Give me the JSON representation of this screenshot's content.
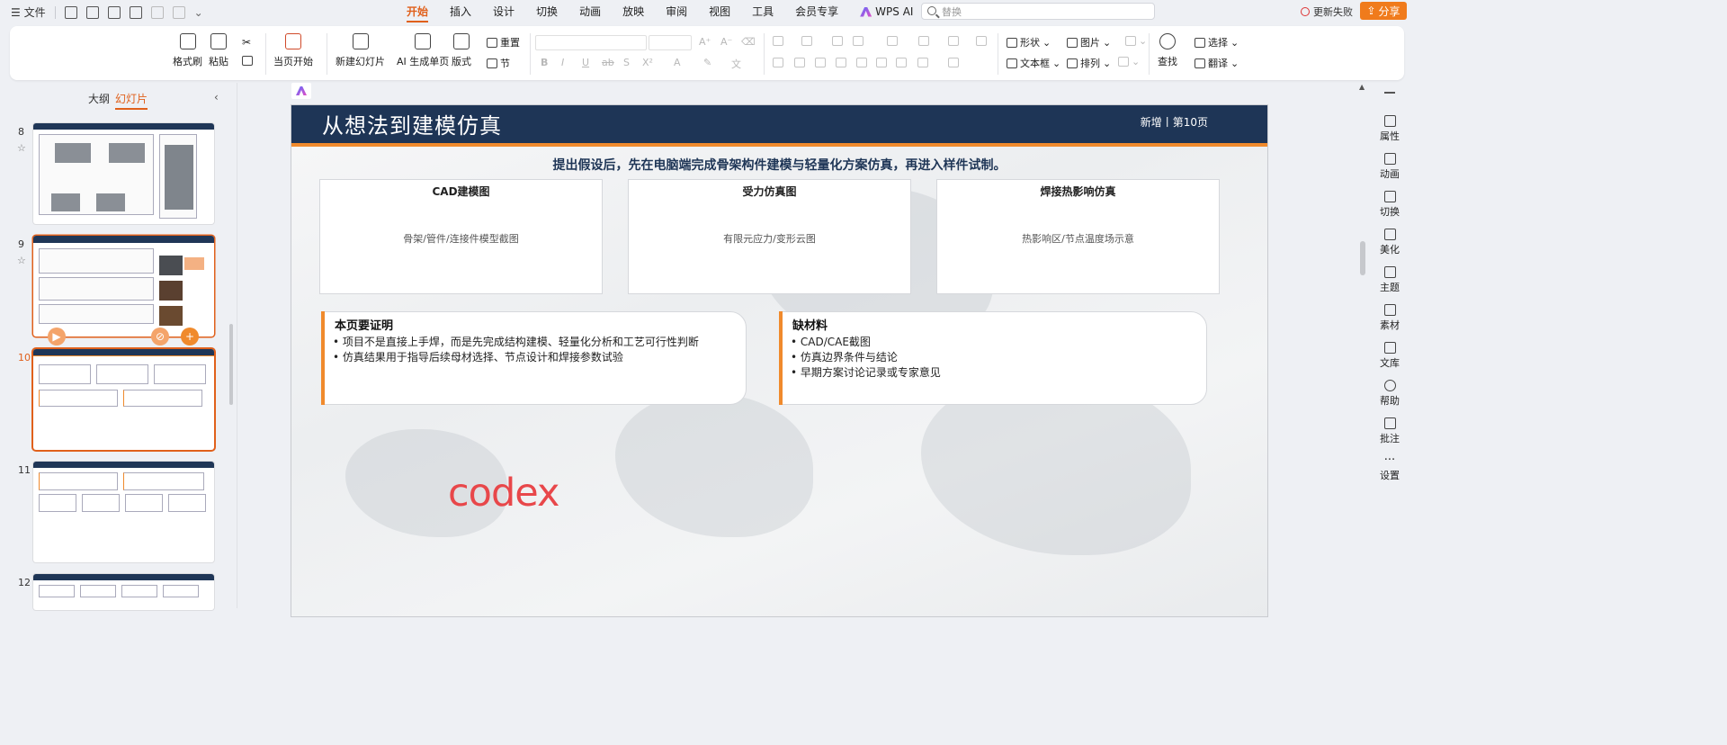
{
  "titlebar": {
    "menu_label": "☰ 文件",
    "tabs": [
      "开始",
      "插入",
      "设计",
      "切换",
      "动画",
      "放映",
      "审阅",
      "视图",
      "工具",
      "会员专享",
      "WPS AI"
    ],
    "active_tab": "开始",
    "search_placeholder": "替换",
    "sync_label": "更新失败",
    "share_label": "分享"
  },
  "ribbon": {
    "format_painter": "格式刷",
    "paste": "粘贴",
    "from_current": "当页开始",
    "new_slide": "新建幻灯片",
    "ai_generate": "AI 生成单页",
    "layout": "版式",
    "reset": "重置",
    "section": "节",
    "shape": "形状",
    "picture": "图片",
    "textbox": "文本框",
    "arrange": "排列",
    "find": "查找",
    "select": "选择",
    "translate": "翻译",
    "font_styles": [
      "B",
      "I",
      "U",
      "ab",
      "S",
      "X²",
      "A",
      "✎",
      "文"
    ]
  },
  "left_panel": {
    "tab_outline": "大纲",
    "tab_slides": "幻灯片",
    "slide_numbers": [
      "8",
      "9",
      "10",
      "11",
      "12"
    ],
    "current_slide": "10"
  },
  "slide": {
    "title": "从想法到建模仿真",
    "tag": "新增丨第10页",
    "subtitle": "提出假设后，先在电脑端完成骨架构件建模与轻量化方案仿真，再进入样件试制。",
    "cards": [
      {
        "title": "CAD建模图",
        "desc": "骨架/管件/连接件模型截图"
      },
      {
        "title": "受力仿真图",
        "desc": "有限元应力/变形云图"
      },
      {
        "title": "焊接热影响仿真",
        "desc": "热影响区/节点温度场示意"
      }
    ],
    "proof": {
      "heading": "本页要证明",
      "items": [
        "• 项目不是直接上手焊，而是先完成结构建模、轻量化分析和工艺可行性判断",
        "• 仿真结果用于指导后续母材选择、节点设计和焊接参数试验"
      ]
    },
    "missing": {
      "heading": "缺材料",
      "items": [
        "• CAD/CAE截图",
        "• 仿真边界条件与结论",
        "• 早期方案讨论记录或专家意见"
      ]
    },
    "watermark": "codex"
  },
  "right_panel": [
    "属性",
    "动画",
    "切换",
    "美化",
    "主题",
    "素材",
    "文库",
    "帮助",
    "批注",
    "设置"
  ],
  "colors": {
    "accent": "#e0601b",
    "slide_header": "#1e3556",
    "slide_orange": "#f08a2c",
    "codex_red": "#e8474a"
  }
}
